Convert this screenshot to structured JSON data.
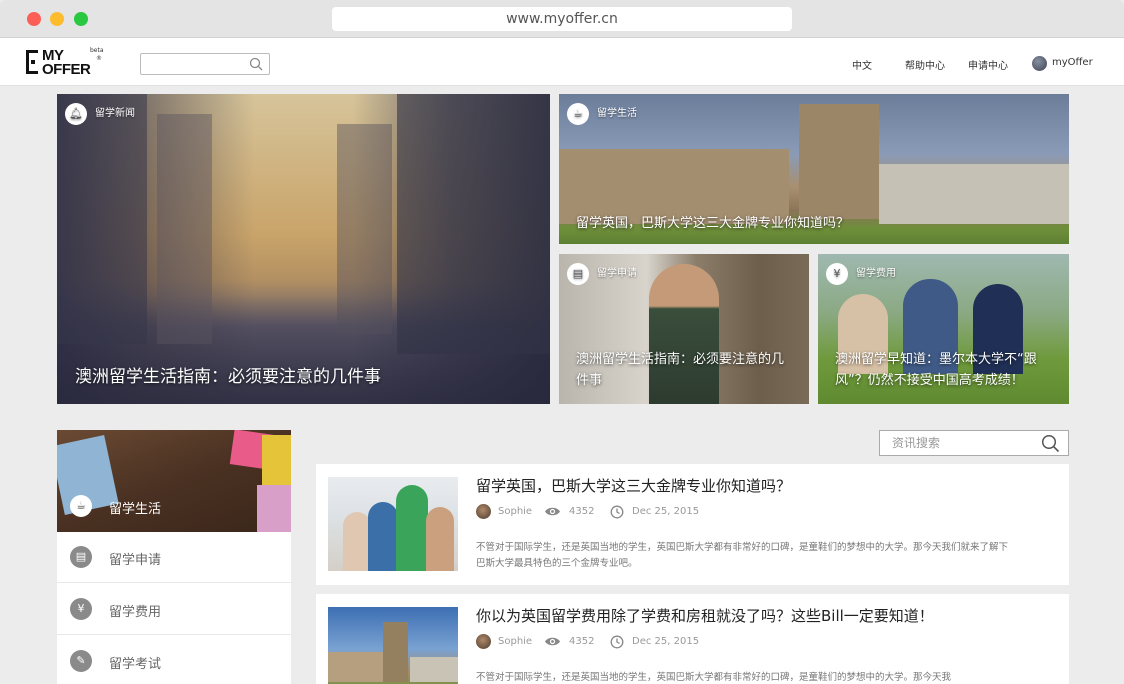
{
  "browser": {
    "url": "www.myoffer.cn"
  },
  "header": {
    "logo": {
      "line1": "MY",
      "line2": "OFFER",
      "badge": "beta"
    },
    "search": {
      "placeholder": ""
    },
    "nav": {
      "language": "中文",
      "help": "帮助中心",
      "apply": "申请中心",
      "account": "myOffer"
    }
  },
  "hero": {
    "tiles": [
      {
        "category": "留学新闻",
        "title": "澳洲留学生活指南：必须要注意的几件事",
        "icon": "bell-icon"
      },
      {
        "category": "留学生活",
        "title": "留学英国，巴斯大学这三大金牌专业你知道吗？",
        "icon": "coffee-icon"
      },
      {
        "category": "留学申请",
        "title": "澳洲留学生活指南：必须要注意的几件事",
        "icon": "document-icon"
      },
      {
        "category": "留学费用",
        "title": "澳洲留学早知道：墨尔本大学不“跟风”？仍然不接受中国高考成绩！",
        "icon": "yen-icon"
      }
    ]
  },
  "sidebar": {
    "items": [
      {
        "label": "留学生活",
        "icon": "coffee-icon",
        "active": true
      },
      {
        "label": "留学申请",
        "icon": "document-icon",
        "active": false
      },
      {
        "label": "留学费用",
        "icon": "yen-icon",
        "active": false
      },
      {
        "label": "留学考试",
        "icon": "pencil-icon",
        "active": false
      }
    ]
  },
  "news_search": {
    "placeholder": "资讯搜索"
  },
  "articles": [
    {
      "title": "留学英国，巴斯大学这三大金牌专业你知道吗？",
      "author": "Sophie",
      "views": "4352",
      "date": "Dec 25, 2015",
      "excerpt": "不管对于国际学生，还是英国当地的学生，英国巴斯大学都有非常好的口碑，是童鞋们的梦想中的大学。那今天我们就来了解下巴斯大学最具特色的三个金牌专业吧。"
    },
    {
      "title": "你以为英国留学费用除了学费和房租就没了吗？这些Bill一定要知道！",
      "author": "Sophie",
      "views": "4352",
      "date": "Dec 25, 2015",
      "excerpt": "不管对于国际学生，还是英国当地的学生，英国巴斯大学都有非常好的口碑，是童鞋们的梦想中的大学。那今天我"
    }
  ],
  "colors": {
    "background": "#ececec",
    "card": "#ffffff",
    "text_primary": "#222222",
    "text_meta": "#999999"
  }
}
